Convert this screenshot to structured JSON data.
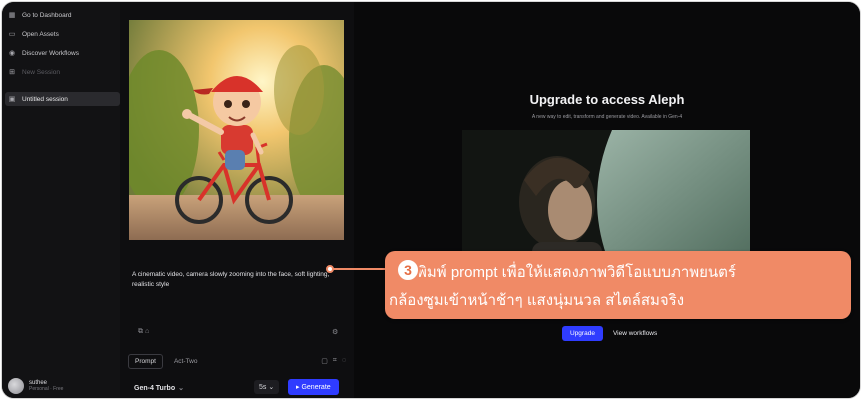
{
  "sidebar": {
    "items": [
      {
        "label": "Go to Dashboard",
        "icon": "dashboard-icon"
      },
      {
        "label": "Open Assets",
        "icon": "folder-icon"
      },
      {
        "label": "Discover Workflows",
        "icon": "discover-icon"
      },
      {
        "label": "New Session",
        "icon": "new-session-icon"
      },
      {
        "label": "Untitled session",
        "icon": "session-icon"
      }
    ],
    "user": {
      "name": "suthee",
      "plan": "Personal · Free"
    }
  },
  "left_panel": {
    "prompt_text": "A cinematic video, camera slowly zooming into the face, soft lighting, realistic style",
    "tabs": [
      {
        "label": "Prompt"
      },
      {
        "label": "Act-Two"
      }
    ],
    "model": "Gen-4 Turbo",
    "duration": "5s",
    "generate_label": "Generate"
  },
  "main": {
    "title": "Upgrade to access Aleph",
    "subtitle": "A new way to edit, transform and generate video. Available in Gen-4",
    "upgrade_label": "Upgrade",
    "workflows_label": "View workflows"
  },
  "callout": {
    "number": "3",
    "line1": "พิมพ์ prompt เพื่อให้แสดงภาพวิดีโอแบบภาพยนตร์",
    "line2": "กล้องซูมเข้าหน้าช้าๆ แสงนุ่มนวล สไตล์สมจริง",
    "color": "#f08a66"
  },
  "colors": {
    "accent": "#2f3cff",
    "background": "#0b0b0c"
  }
}
